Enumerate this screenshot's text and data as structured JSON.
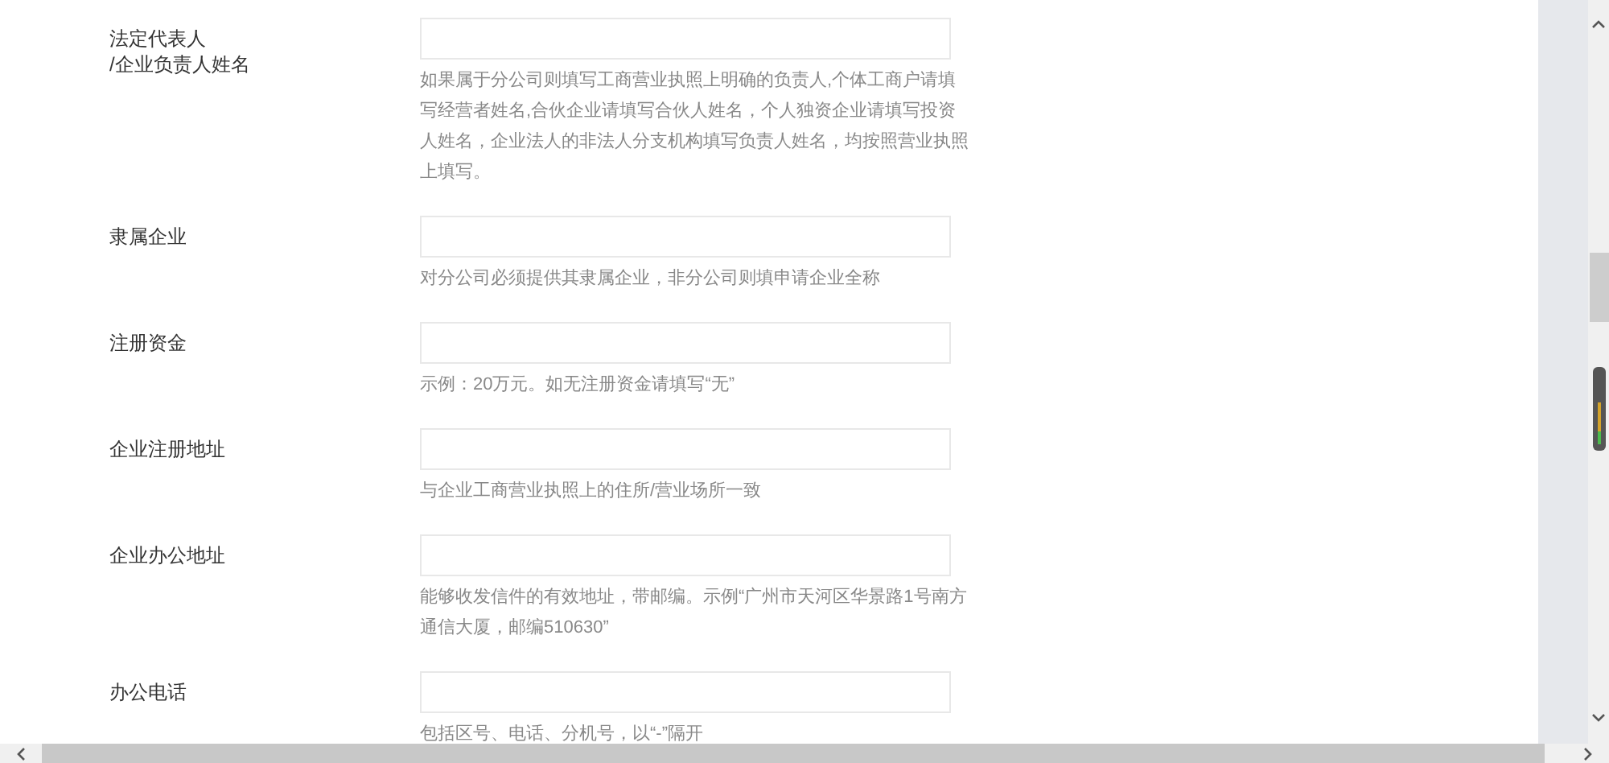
{
  "form_rows": [
    {
      "label": "法定代表人\n/企业负责人姓名",
      "hint": "如果属于分公司则填写工商营业执照上明确的负责人,个体工商户请填写经营者姓名,合伙企业请填写合伙人姓名，个人独资企业请填写投资人姓名，企业法人的非法人分支机构填写负责人姓名，均按照营业执照上填写。"
    },
    {
      "label": "隶属企业",
      "hint": "对分公司必须提供其隶属企业，非分公司则填申请企业全称"
    },
    {
      "label": "注册资金",
      "hint": "示例：20万元。如无注册资金请填写“无”"
    },
    {
      "label": "企业注册地址",
      "hint": "与企业工商营业执照上的住所/营业场所一致"
    },
    {
      "label": "企业办公地址",
      "hint": "能够收发信件的有效地址，带邮编。示例“广州市天河区华景路1号南方通信大厦，邮编510630”"
    },
    {
      "label": "办公电话",
      "hint": "包括区号、电话、分机号，以“-”隔开"
    }
  ]
}
